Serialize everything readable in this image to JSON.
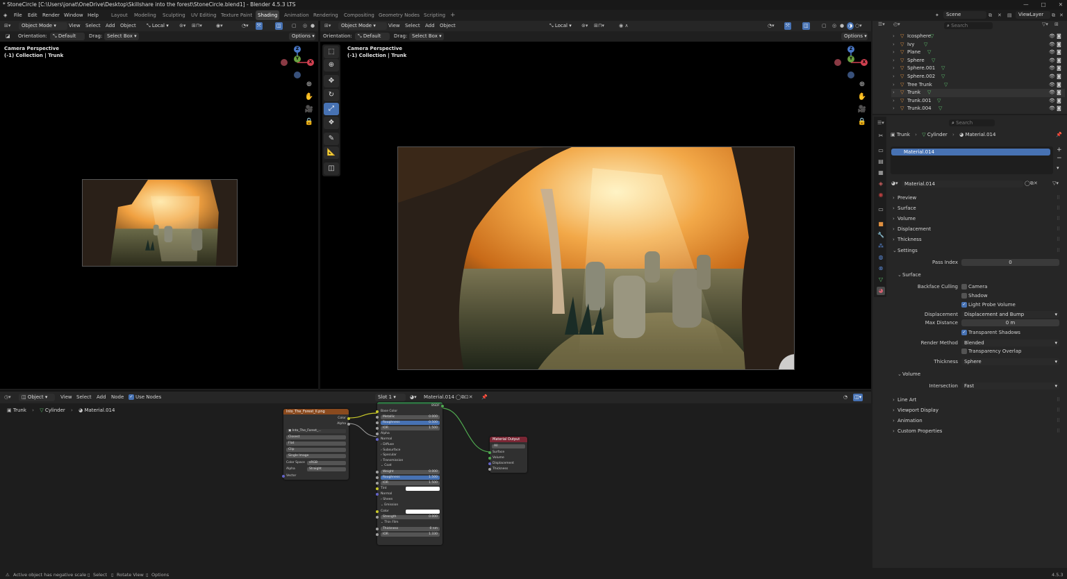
{
  "title": "* StoneCircle [C:\\Users\\jonat\\OneDrive\\Desktop\\Skillshare into the forest\\StoneCircle.blend1] - Blender 4.5.3 LTS",
  "menu": [
    "File",
    "Edit",
    "Render",
    "Window",
    "Help"
  ],
  "workspaces": [
    "Layout",
    "Modeling",
    "Sculpting",
    "UV Editing",
    "Texture Paint",
    "Shading",
    "Animation",
    "Rendering",
    "Compositing",
    "Geometry Nodes",
    "Scripting"
  ],
  "scene": {
    "name": "Scene",
    "view_layer": "ViewLayer"
  },
  "viewport": {
    "mode": "Object Mode",
    "menus": [
      "View",
      "Select",
      "Add",
      "Object"
    ],
    "transform": "Local",
    "orientation_label": "Orientation:",
    "orientation": "Default",
    "drag_label": "Drag:",
    "drag": "Select Box",
    "options": "Options",
    "overlay_title": "Camera Perspective",
    "overlay_sub": "(-1) Collection | Trunk",
    "gizmo": {
      "z": "Z",
      "y": "Y",
      "x": "X"
    }
  },
  "outliner": {
    "search": "Search",
    "items": [
      "Icosphere",
      "Ivy",
      "Plane",
      "Sphere",
      "Sphere.001",
      "Sphere.002",
      "Tree Trunk",
      "Trunk",
      "Trunk.001",
      "Trunk.004"
    ]
  },
  "properties": {
    "search": "Search",
    "breadcrumb": [
      "Trunk",
      "Cylinder",
      "Material.014"
    ],
    "slot": "Material.014",
    "material": "Material.014",
    "panels": [
      "Preview",
      "Surface",
      "Volume",
      "Displacement",
      "Thickness",
      "Settings"
    ],
    "pass_index_label": "Pass Index",
    "pass_index": "0",
    "surface_label": "Surface",
    "backface_label": "Backface Culling",
    "camera": "Camera",
    "shadow": "Shadow",
    "light_probe": "Light Probe Volume",
    "displacement_label": "Displacement",
    "displacement": "Displacement and Bump",
    "max_distance_label": "Max Distance",
    "max_distance": "0 m",
    "transparent_shadows": "Transparent Shadows",
    "render_method_label": "Render Method",
    "render_method": "Blended",
    "transparency_overlap": "Transparency Overlap",
    "thickness_label": "Thickness",
    "thickness": "Sphere",
    "volume_label": "Volume",
    "intersection_label": "Intersection",
    "intersection": "Fast",
    "bottom_panels": [
      "Line Art",
      "Viewport Display",
      "Animation",
      "Custom Properties"
    ]
  },
  "node_editor": {
    "type": "Object",
    "menus": [
      "View",
      "Select",
      "Add",
      "Node"
    ],
    "use_nodes": "Use Nodes",
    "slot": "Slot 1",
    "material": "Material.014",
    "breadcrumb": [
      "Trunk",
      "Cylinder",
      "Material.014"
    ],
    "image_node": {
      "title": "Into_The_Forest_ll.png",
      "out_color": "Color",
      "out_alpha": "Alpha",
      "image": "Into_The_Forest_...",
      "interp": "Closest",
      "proj": "Flat",
      "ext": "Clip",
      "src": "Single Image",
      "cs_label": "Color Space",
      "cs": "sRGB",
      "alpha_label": "Alpha",
      "alpha": "Straight",
      "vector": "Vector"
    },
    "bsdf": {
      "out": "BSDF",
      "rows": [
        {
          "t": "socket",
          "l": "Base Color"
        },
        {
          "t": "field",
          "l": "Metallic",
          "v": "0.000"
        },
        {
          "t": "field",
          "l": "Roughness",
          "v": "0.500",
          "hl": true
        },
        {
          "t": "field",
          "l": "IOR",
          "v": "1.500"
        },
        {
          "t": "socket",
          "l": "Alpha"
        },
        {
          "t": "socket",
          "l": "Normal"
        },
        {
          "t": "sub",
          "l": "Diffuse"
        },
        {
          "t": "sub",
          "l": "Subsurface"
        },
        {
          "t": "sub",
          "l": "Specular"
        },
        {
          "t": "sub",
          "l": "Transmission"
        },
        {
          "t": "open",
          "l": "Coat"
        },
        {
          "t": "field",
          "l": "Weight",
          "v": "0.000"
        },
        {
          "t": "field",
          "l": "Roughness",
          "v": "1.500",
          "hl": true
        },
        {
          "t": "field",
          "l": "IOR",
          "v": "1.500"
        },
        {
          "t": "color",
          "l": "Tint"
        },
        {
          "t": "socket",
          "l": "Normal"
        },
        {
          "t": "sub",
          "l": "Sheen"
        },
        {
          "t": "open",
          "l": "Emission"
        },
        {
          "t": "color",
          "l": "Color"
        },
        {
          "t": "field",
          "l": "Strength",
          "v": "0.000"
        },
        {
          "t": "open",
          "l": "Thin Film"
        },
        {
          "t": "field",
          "l": "Thickness",
          "v": "0 nm"
        },
        {
          "t": "field",
          "l": "IOR",
          "v": "1.330"
        }
      ]
    },
    "output": {
      "title": "Material Output",
      "target": "All",
      "inputs": [
        "Surface",
        "Volume",
        "Displacement",
        "Thickness"
      ]
    }
  },
  "status": {
    "left": "Active object has negative scale",
    "select": "Select",
    "rotate": "Rotate View",
    "options": "Options",
    "version": "4.5.3"
  },
  "colors": {
    "accent": "#4772b3",
    "orange": "#e09040",
    "green": "#5ec36e"
  }
}
